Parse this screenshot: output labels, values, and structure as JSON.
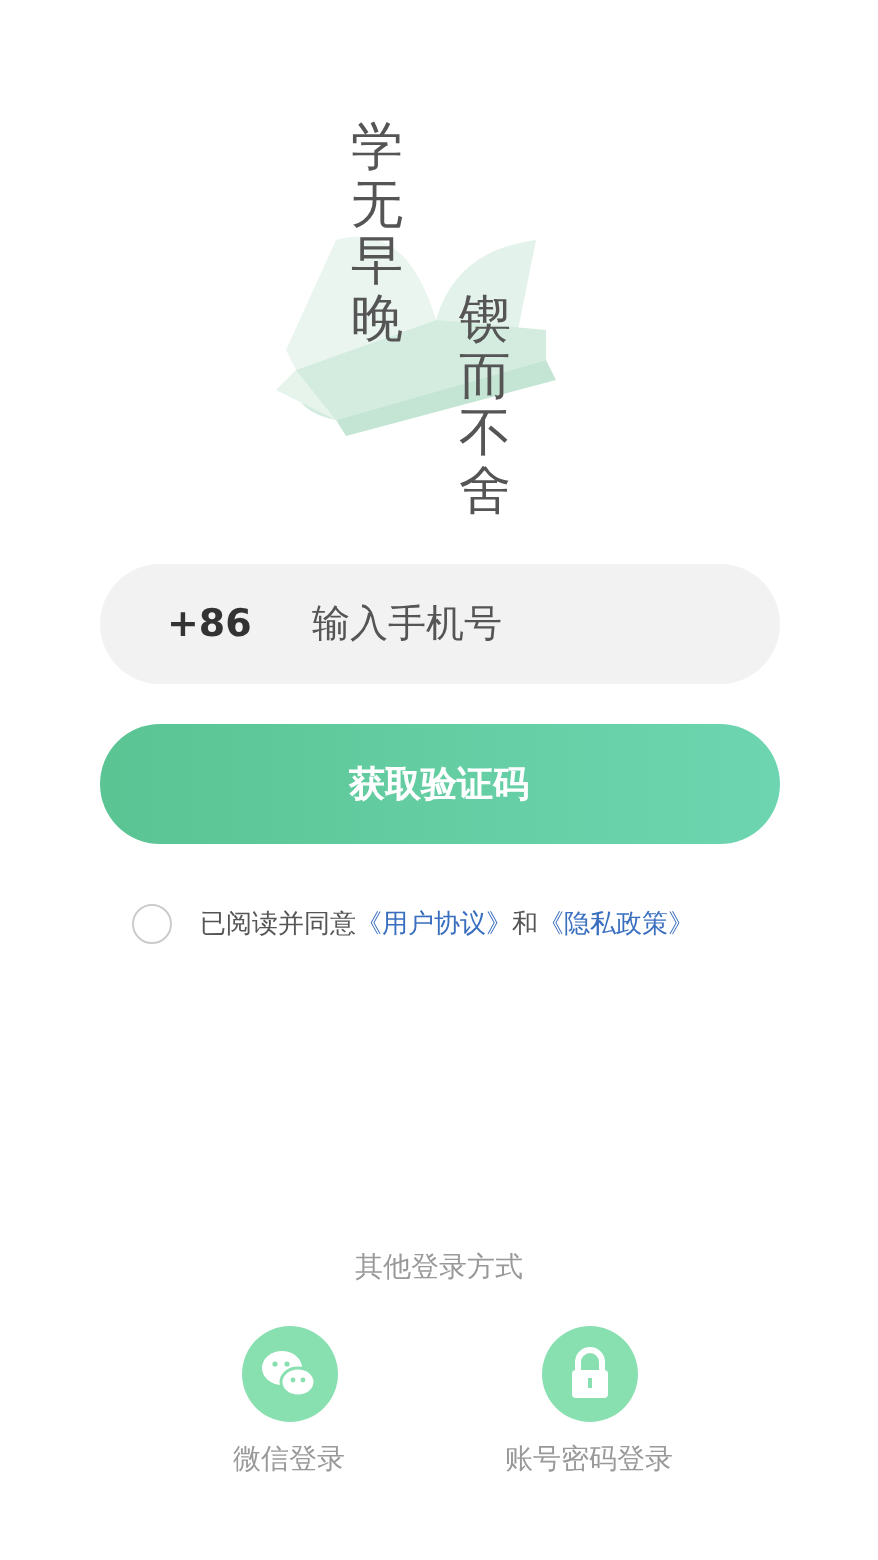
{
  "logo": {
    "left_column": "学无早晚",
    "right_column": "锲而不舍"
  },
  "phone": {
    "prefix": "+86",
    "placeholder": "输入手机号"
  },
  "submit_button": "获取验证码",
  "agreement": {
    "checked": false,
    "text": "已阅读并同意",
    "link_1": "《用户协议》",
    "joiner": "和",
    "link_2": "《隐私政策》"
  },
  "other_login": {
    "title": "其他登录方式",
    "options": [
      {
        "kind": "wechat",
        "label": "微信登录"
      },
      {
        "kind": "password",
        "label": "账号密码登录"
      }
    ]
  }
}
